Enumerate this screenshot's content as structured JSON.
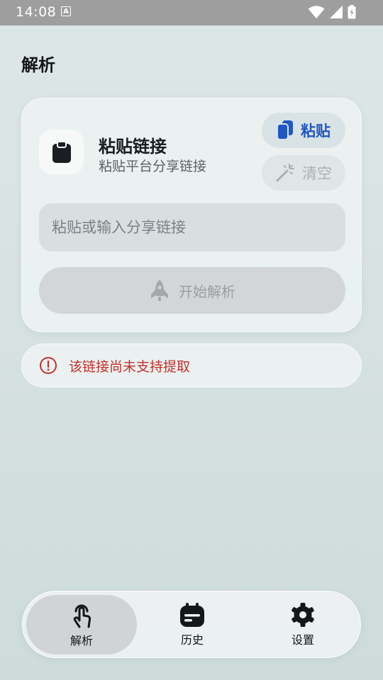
{
  "status_bar": {
    "time": "14:08",
    "a_label": "A"
  },
  "page": {
    "title": "解析"
  },
  "card": {
    "title": "粘贴链接",
    "subtitle": "粘贴平台分享链接",
    "paste_label": "粘贴",
    "clear_label": "清空",
    "input_placeholder": "粘贴或输入分享链接",
    "input_value": "",
    "parse_label": "开始解析"
  },
  "error": {
    "message": "该链接尚未支持提取"
  },
  "nav": {
    "items": [
      {
        "label": "解析",
        "icon": "touch-gesture-icon",
        "active": true
      },
      {
        "label": "历史",
        "icon": "history-calendar-icon",
        "active": false
      },
      {
        "label": "设置",
        "icon": "gear-icon",
        "active": false
      }
    ]
  },
  "colors": {
    "accent": "#1f57c3",
    "error": "#c0312b",
    "status_bar": "#9e9e9e"
  }
}
